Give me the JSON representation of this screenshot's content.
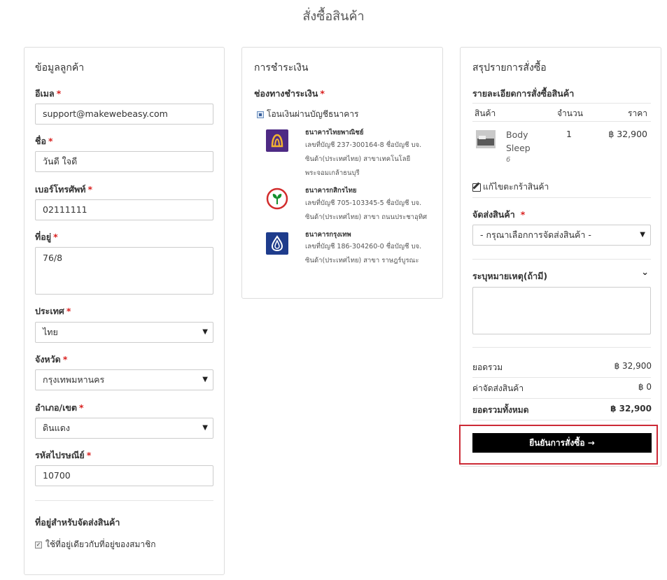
{
  "page_title": "สั่งซื้อสินค้า",
  "customer": {
    "title": "ข้อมูลลูกค้า",
    "email_label": "อีเมล",
    "email_value": "support@makewebeasy.com",
    "name_label": "ชื่อ",
    "name_value": "วันดี ใจดี",
    "phone_label": "เบอร์โทรศัพท์",
    "phone_value": "02111111",
    "address_label": "ที่อยู่",
    "address_value": "76/8",
    "country_label": "ประเทศ",
    "country_value": "ไทย",
    "province_label": "จังหวัด",
    "province_value": "กรุงเทพมหานคร",
    "district_label": "อำเภอ/เขต",
    "district_value": "ดินแดง",
    "postcode_label": "รหัสไปรษณีย์",
    "postcode_value": "10700",
    "shipping_address_title": "ที่อยู่สำหรับจัดส่งสินค้า",
    "same_address_label": "ใช้ที่อยู่เดียวกับที่อยู่ของสมาชิก",
    "required_mark": "*"
  },
  "payment": {
    "title": "การชำระเงิน",
    "channel_label": "ช่องทางชำระเงิน",
    "method_label": "โอนเงินผ่านบัญชีธนาคาร",
    "banks": [
      {
        "name": "ธนาคารไทยพาณิชย์",
        "line1": "เลขที่บัญชี 237-300164-8 ชื่อบัญชี บจ.",
        "line2": "ซินด้า(ประเทศไทย) สาขาเทคโนโลยี",
        "line3": "พระจอมเกล้าธนบุรี",
        "color": "#4e2a84"
      },
      {
        "name": "ธนาคารกสิกรไทย",
        "line1": "เลขที่บัญชี 705-103345-5 ชื่อบัญชี บจ.",
        "line2": "ซินด้า(ประเทศไทย) สาขา ถนนประชาอุทิศ",
        "line3": "",
        "color": "#138f2d"
      },
      {
        "name": "ธนาคารกรุงเทพ",
        "line1": "เลขที่บัญชี 186-304260-0 ชื่อบัญชี บจ.",
        "line2": "ซินด้า(ประเทศไทย) สาขา ราษฎร์บูรณะ",
        "line3": "",
        "color": "#1e3c8c"
      }
    ]
  },
  "summary": {
    "title": "สรุปรายการสั่งซื้อ",
    "details_label": "รายละเอียดการสั่งซื้อสินค้า",
    "col_product": "สินค้า",
    "col_qty": "จำนวน",
    "col_price": "ราคา",
    "item_name_1": "Body",
    "item_name_2": "Sleep",
    "item_sub": "6",
    "item_qty": "1",
    "item_price": "฿ 32,900",
    "edit_cart": "แก้ไขตะกร้าสินค้า",
    "shipping_label": "จัดส่งสินค้า",
    "shipping_placeholder": "- กรุณาเลือกการจัดส่งสินค้า -",
    "note_label": "ระบุหมายเหตุ(ถ้ามี)",
    "subtotal_label": "ยอดรวม",
    "subtotal_value": "฿ 32,900",
    "shipping_cost_label": "ค่าจัดส่งสินค้า",
    "shipping_cost_value": "฿ 0",
    "total_label": "ยอดรวมทั้งหมด",
    "total_value": "฿ 32,900",
    "confirm_label": "ยืนยันการสั่งซื้อ →"
  },
  "colors": {
    "required": "#d9201f",
    "highlight": "#cc2a36",
    "button": "#000000"
  }
}
